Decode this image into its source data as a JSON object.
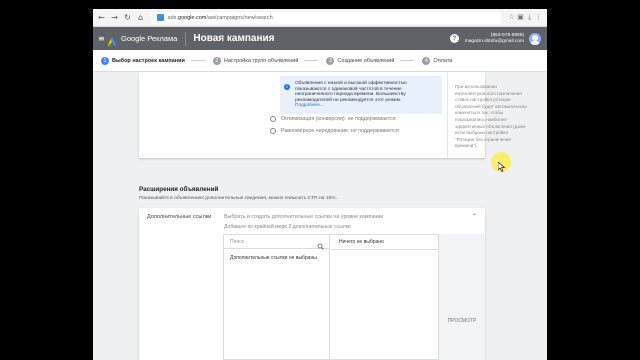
{
  "browser": {
    "url_prefix": "ads.",
    "url_domain": "google.com",
    "url_path": "/aw/campaigns/new/search",
    "secure_badge": "",
    "nav_back": "←",
    "nav_forward": "→",
    "nav_reload": "↻",
    "nav_home": "⌂"
  },
  "header": {
    "menu_icon": "≡",
    "brand": "Google Реклама",
    "title": "Новая кампания",
    "help": "?",
    "account_id": "(853-579-5895)",
    "account_email": "magazin.shtofu@gmail.com"
  },
  "steps": [
    {
      "num": "1",
      "label": "Выбор настроек кампании"
    },
    {
      "num": "2",
      "label": "Настройка групп объявлений"
    },
    {
      "num": "3",
      "label": "Создание объявлений"
    },
    {
      "num": "4",
      "label": "Оплата"
    }
  ],
  "rotation": {
    "info_text": "Объявления с низкой и высокой эффективностью показываются с одинаковой частотой в течение неограниченного периода времени. Большинству рекламодателей не рекомендуется этот режим.",
    "info_link": "Подробнее...",
    "option_1": "Оптимизация (конверсии): не поддерживается",
    "option_2": "Равномерное чередование: не поддерживается",
    "help_text": "При использовании интеллектуального назначения ставок настройка ротации объявлений будет автоматически изменяться так, чтобы показывались наиболее эффективные объявления (даже если выбрана настройка \"Ротация без ограничения времени\")."
  },
  "extensions": {
    "title": "Расширения объявлений",
    "subtitle": "Показывайте в объявлениях дополнительные сведения, можно повысить CTR на 15%.",
    "sitelinks_label": "Дополнительные ссылки",
    "hint_1": "Выбрать и создать дополнительные ссылки на уровне кампании",
    "hint_2": "Добавьте по крайней мере 2 дополнительные ссылки",
    "search_placeholder": "Поиск",
    "list_item": "Дополнительные ссылки не выбраны",
    "selected_header": "Ничего не выбрано",
    "preview_label": "ПРОСМОТР",
    "collapse_icon": "⌃"
  }
}
